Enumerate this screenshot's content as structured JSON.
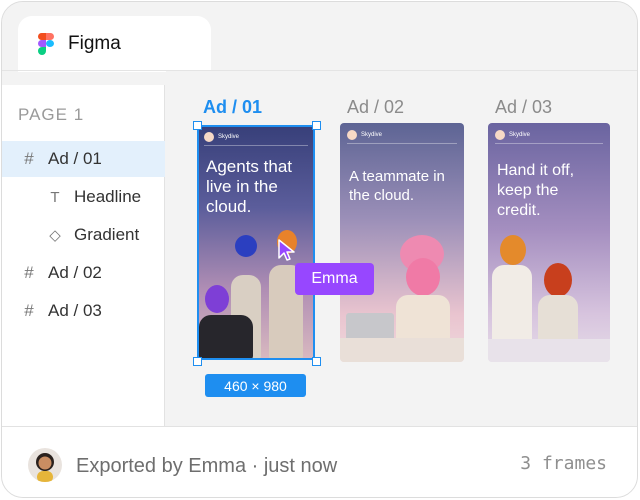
{
  "app": {
    "tab_title": "Figma",
    "logo_icon": "figma-logo-icon"
  },
  "sidebar": {
    "page_label": "PAGE 1",
    "layers": [
      {
        "label": "Ad / 01",
        "icon": "frame-icon",
        "selected": true
      },
      {
        "label": "Headline",
        "icon": "text-icon"
      },
      {
        "label": "Gradient",
        "icon": "diamond-icon"
      },
      {
        "label": "Ad / 02",
        "icon": "frame-icon"
      },
      {
        "label": "Ad / 03",
        "icon": "frame-icon"
      }
    ]
  },
  "canvas": {
    "frames": [
      {
        "label": "Ad / 01",
        "brand": "Skydive",
        "headline": "Agents that live in the cloud.",
        "selected": true
      },
      {
        "label": "Ad / 02",
        "brand": "Skydive",
        "headline": "A teammate in the cloud."
      },
      {
        "label": "Ad / 03",
        "brand": "Skydive",
        "headline": "Hand it off, keep the credit."
      }
    ],
    "selection_size": "460 × 980",
    "collaborator_name": "Emma",
    "colors": {
      "selection": "#1e8ef0",
      "collaborator": "#9747ff"
    }
  },
  "footer": {
    "export_text": "Exported by Emma · just now",
    "frames_count": "3 frames"
  }
}
